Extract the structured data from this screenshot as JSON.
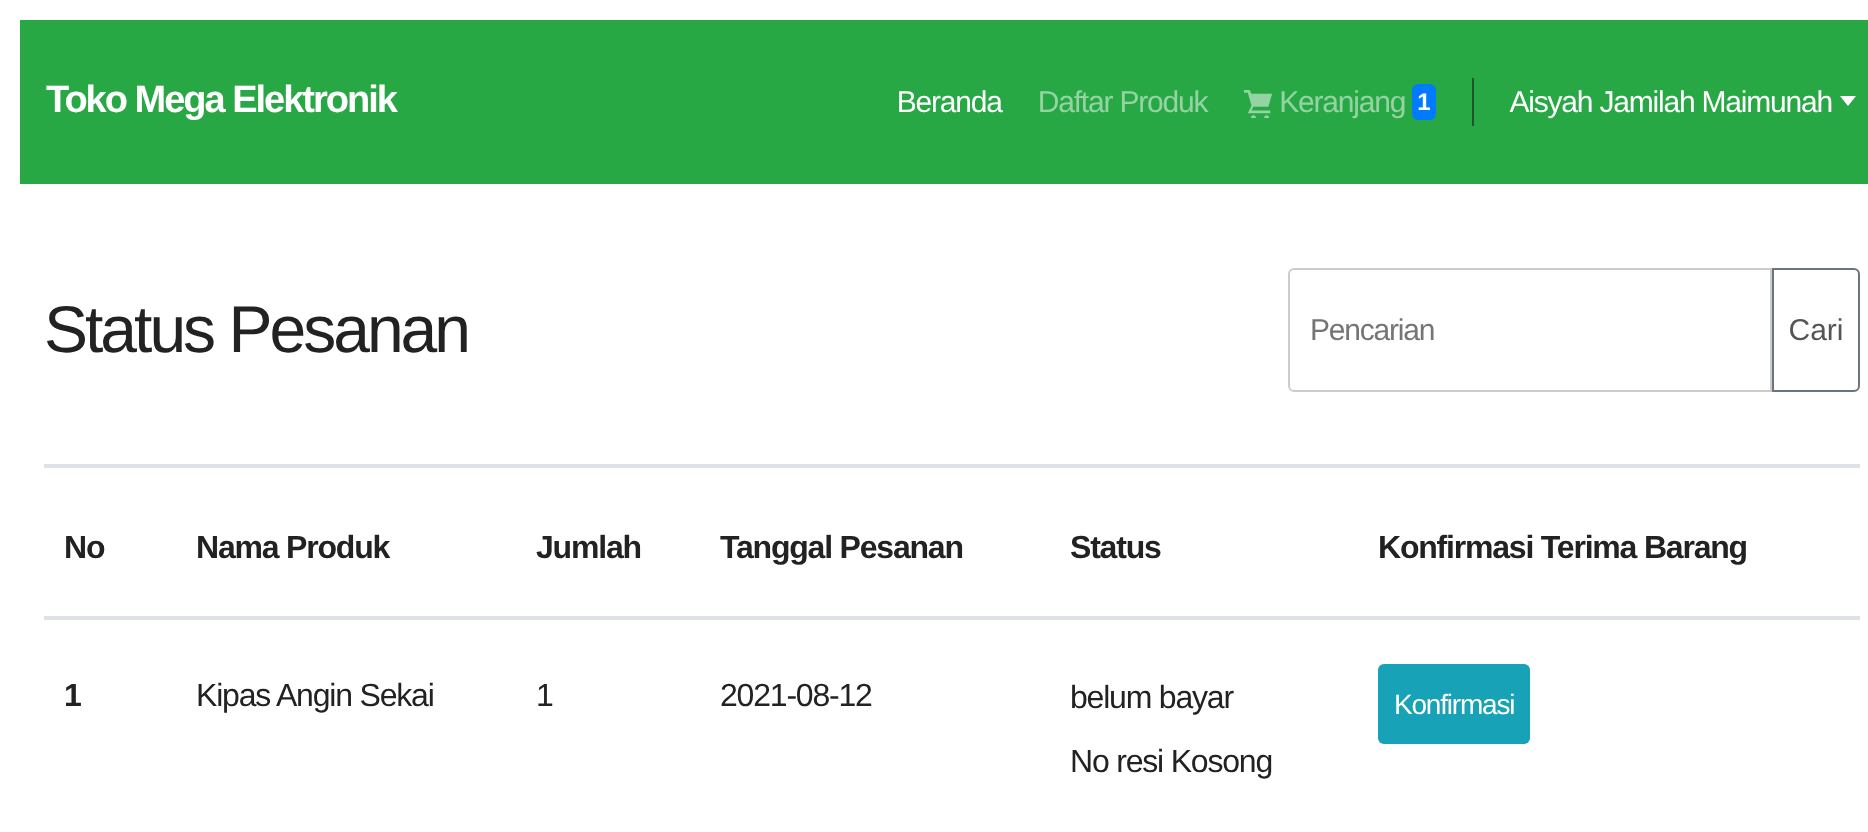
{
  "navbar": {
    "brand": "Toko Mega Elektronik",
    "links": [
      {
        "label": "Beranda",
        "selected": true,
        "kind": "text"
      },
      {
        "label": "Daftar Produk",
        "selected": false,
        "kind": "text"
      },
      {
        "label": "Keranjang",
        "selected": false,
        "kind": "cart",
        "badge": "1"
      }
    ],
    "user": "Aisyah Jamilah Maimunah"
  },
  "page": {
    "title": "Status Pesanan",
    "search": {
      "placeholder": "Pencarian",
      "button": "Cari"
    }
  },
  "table": {
    "columns": [
      "No",
      "Nama Produk",
      "Jumlah",
      "Tanggal Pesanan",
      "Status",
      "Konfirmasi Terima Barang"
    ],
    "rows": [
      {
        "no": "1",
        "product": "Kipas Angin Sekai",
        "qty": "1",
        "date": "2021-08-12",
        "status": [
          "belum bayar",
          "No resi Kosong"
        ],
        "action": "Konfirmasi"
      }
    ]
  }
}
